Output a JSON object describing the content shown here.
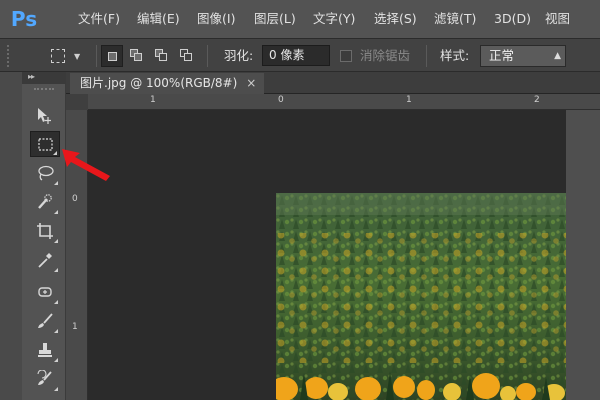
{
  "app": {
    "logo": "Ps",
    "menu": [
      "文件(F)",
      "编辑(E)",
      "图像(I)",
      "图层(L)",
      "文字(Y)",
      "选择(S)",
      "滤镜(T)",
      "3D(D)",
      "视图"
    ]
  },
  "options_bar": {
    "tool_preset_icon": "rect-marquee-icon",
    "selection_modes": [
      "new-selection-icon",
      "add-to-selection-icon",
      "subtract-from-selection-icon",
      "intersect-selection-icon"
    ],
    "feather_label": "羽化:",
    "feather_value": "0 像素",
    "antialias_label": "消除锯齿",
    "antialias_checked": false,
    "style_label": "样式:",
    "style_value": "正常"
  },
  "toolbox": {
    "collapse_glyph": "▸▸",
    "tools": [
      {
        "name": "move-tool-icon",
        "active": false
      },
      {
        "name": "rect-marquee-tool-icon",
        "active": true
      },
      {
        "name": "lasso-tool-icon",
        "active": false
      },
      {
        "name": "quick-selection-tool-icon",
        "active": false
      },
      {
        "name": "crop-tool-icon",
        "active": false
      },
      {
        "name": "eyedropper-tool-icon",
        "active": false
      },
      {
        "name": "spot-healing-tool-icon",
        "active": false
      },
      {
        "name": "brush-tool-icon",
        "active": false
      },
      {
        "name": "clone-stamp-tool-icon",
        "active": false
      },
      {
        "name": "history-brush-tool-icon",
        "active": false
      }
    ]
  },
  "document": {
    "tab_title": "图片.jpg @ 100%(RGB/8#)",
    "tab_close": "×"
  },
  "rulers": {
    "top_labels": [
      "1",
      "0",
      "1",
      "2"
    ],
    "left_labels": [
      "0",
      "1"
    ]
  },
  "colors": {
    "logo_blue": "#52a8ff",
    "annotation_red": "#e8171b",
    "canvas_bg": "#282828"
  }
}
